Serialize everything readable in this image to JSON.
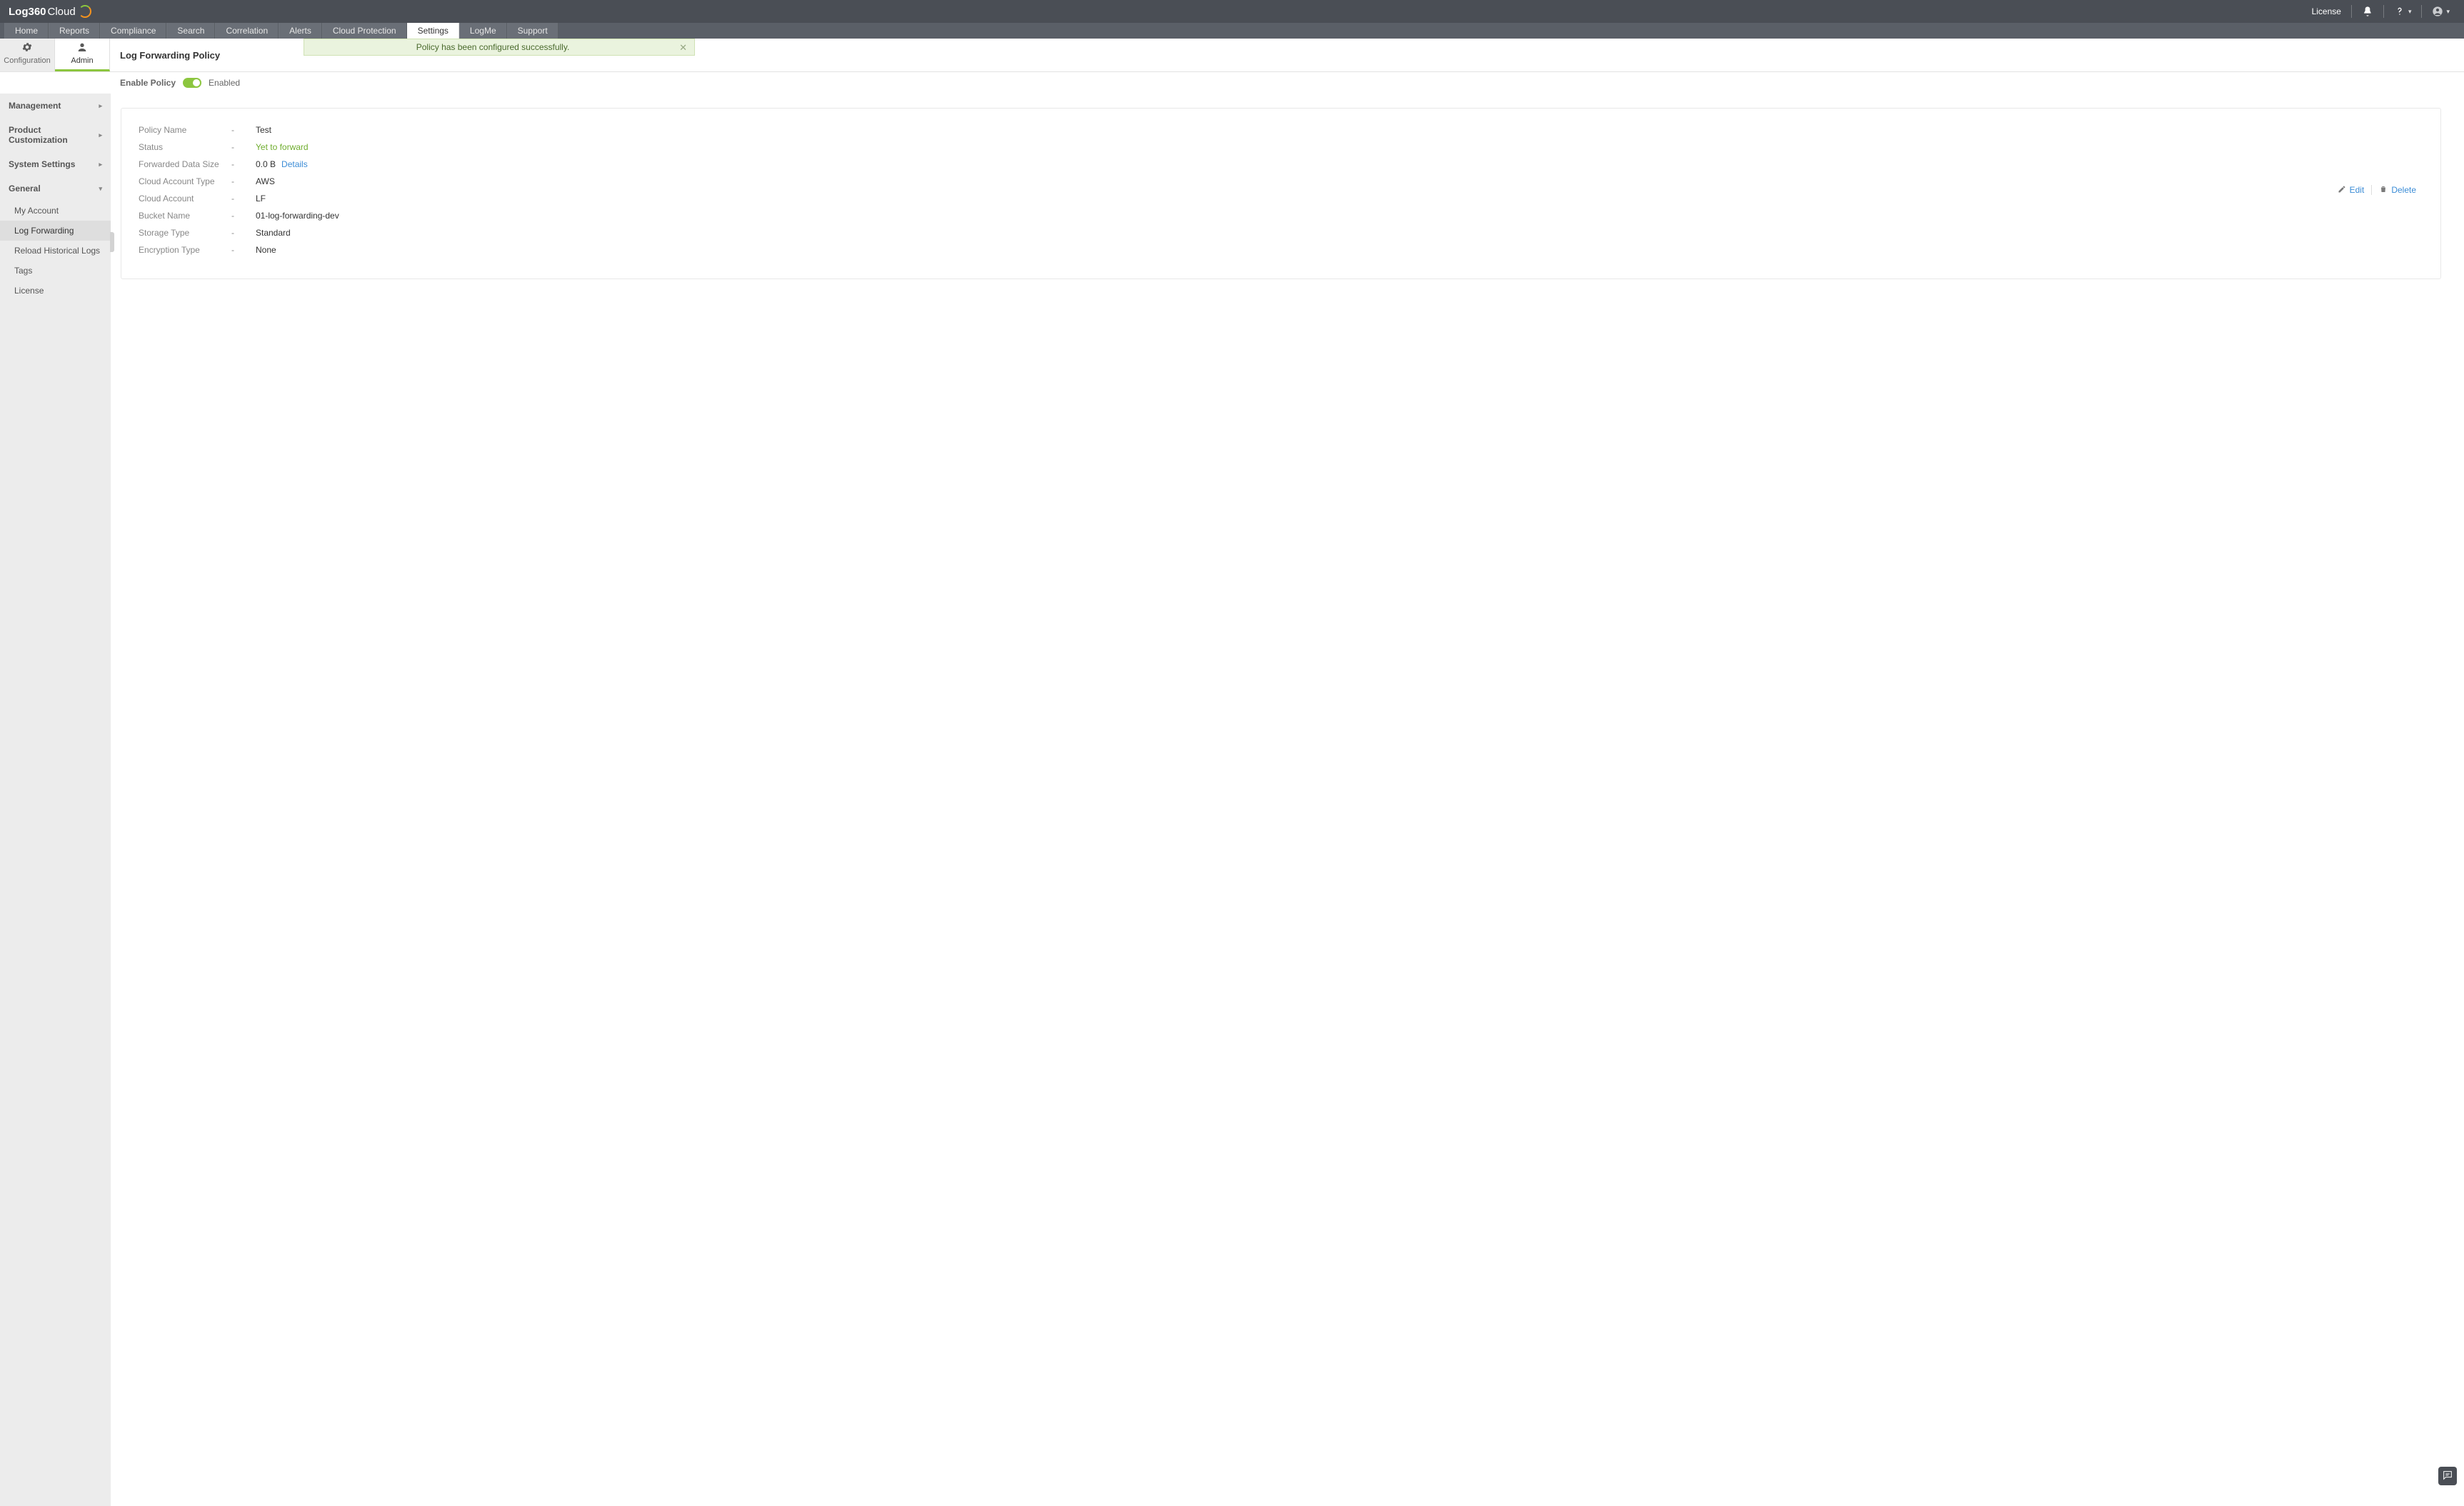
{
  "brand": {
    "bold": "Log360",
    "thin": "Cloud"
  },
  "topbar": {
    "license": "License"
  },
  "nav": {
    "tabs": [
      "Home",
      "Reports",
      "Compliance",
      "Search",
      "Correlation",
      "Alerts",
      "Cloud Protection",
      "Settings",
      "LogMe",
      "Support"
    ],
    "active_index": 7
  },
  "subtabs": {
    "items": [
      "Configuration",
      "Admin"
    ],
    "active_index": 1
  },
  "page": {
    "title": "Log Forwarding Policy",
    "notification": "Policy has been configured successfully.",
    "enable_label": "Enable Policy",
    "enable_state": "Enabled"
  },
  "sidebar": {
    "groups": [
      {
        "label": "Management",
        "expanded": false
      },
      {
        "label": "Product Customization",
        "expanded": false
      },
      {
        "label": "System Settings",
        "expanded": false
      },
      {
        "label": "General",
        "expanded": true,
        "items": [
          "My Account",
          "Log Forwarding",
          "Reload Historical Logs",
          "Tags",
          "License"
        ],
        "active_item_index": 1
      }
    ]
  },
  "card": {
    "actions": {
      "edit": "Edit",
      "delete": "Delete"
    },
    "details_link": "Details",
    "rows": [
      {
        "k": "Policy Name",
        "v": "Test"
      },
      {
        "k": "Status",
        "v": "Yet to forward",
        "green": true
      },
      {
        "k": "Forwarded Data Size",
        "v": "0.0 B",
        "has_details": true
      },
      {
        "k": "Cloud Account Type",
        "v": "AWS"
      },
      {
        "k": "Cloud Account",
        "v": "LF"
      },
      {
        "k": "Bucket Name",
        "v": "01-log-forwarding-dev"
      },
      {
        "k": "Storage Type",
        "v": "Standard"
      },
      {
        "k": "Encryption Type",
        "v": "None"
      }
    ]
  }
}
